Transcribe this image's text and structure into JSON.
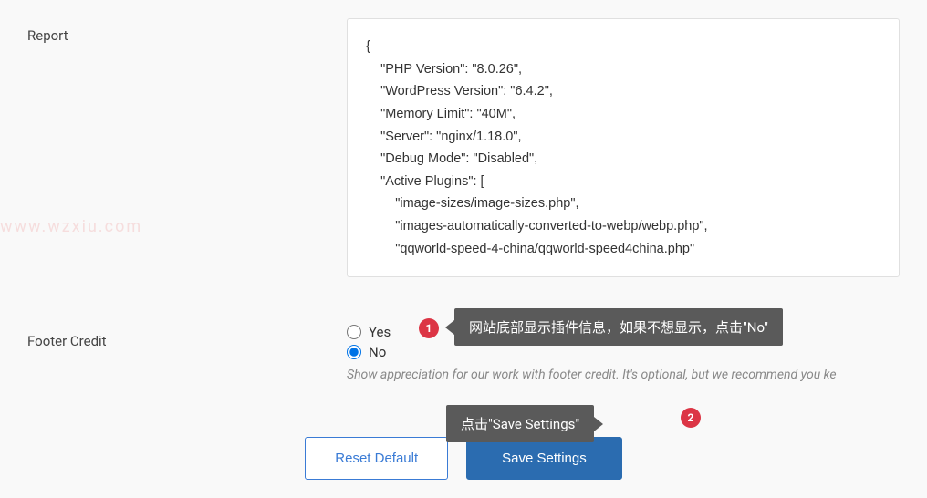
{
  "report": {
    "label": "Report",
    "content": "{\n    \"PHP Version\": \"8.0.26\",\n    \"WordPress Version\": \"6.4.2\",\n    \"Memory Limit\": \"40M\",\n    \"Server\": \"nginx/1.18.0\",\n    \"Debug Mode\": \"Disabled\",\n    \"Active Plugins\": [\n        \"image-sizes/image-sizes.php\",\n        \"images-automatically-converted-to-webp/webp.php\",\n        \"qqworld-speed-4-china/qqworld-speed4china.php\""
  },
  "watermark": "www.wzxiu.com",
  "footer_credit": {
    "label": "Footer Credit",
    "yes_label": "Yes",
    "no_label": "No",
    "help_text": "Show appreciation for our work with footer credit. It's optional, but we recommend you ke"
  },
  "annotations": {
    "badge1": "1",
    "tooltip1": "网站底部显示插件信息，如果不想显示，点击\"No\"",
    "badge2": "2",
    "tooltip2": "点击\"Save Settings\""
  },
  "buttons": {
    "reset": "Reset Default",
    "save": "Save Settings"
  }
}
